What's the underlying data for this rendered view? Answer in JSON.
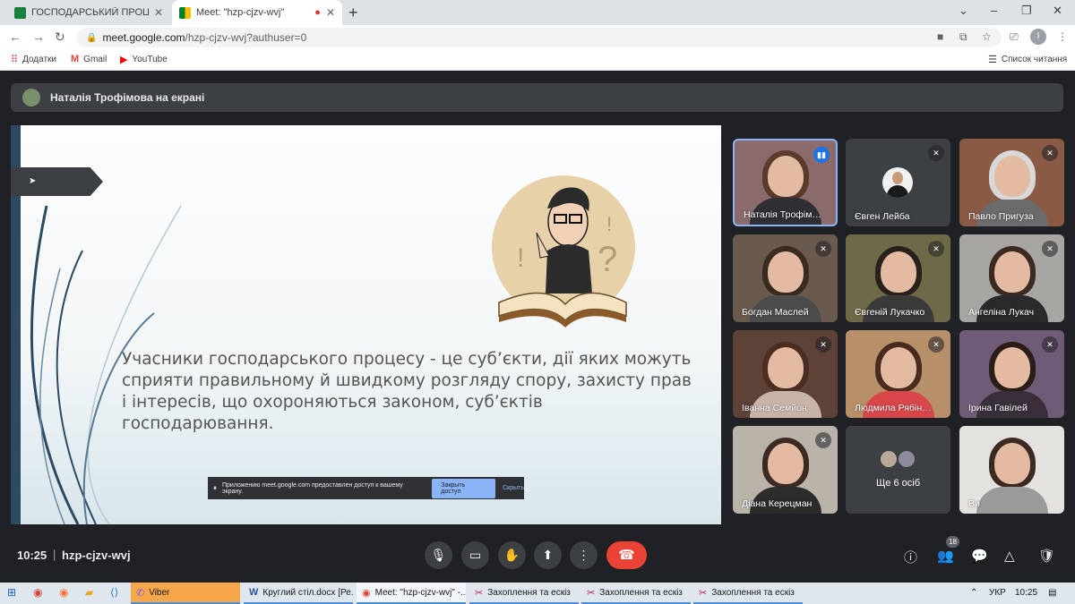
{
  "browser": {
    "tabs": [
      {
        "title": "ГОСПОДАРСЬКИЙ ПРОЦЕС Пр",
        "favicon_color": "#188038"
      },
      {
        "title": "Meet: \"hzp-cjzv-wvj\"",
        "favicon_color": "#00832d",
        "recording": true
      }
    ],
    "new_tab_icon": "plus-icon",
    "window_controls": {
      "minimize": "–",
      "maximize": "❐",
      "close": "✕",
      "dropdown": "⌄"
    },
    "url_host": "meet.google.com",
    "url_path": "/hzp-cjzv-wvj?authuser=0",
    "profile_initial": "I",
    "bookmarks": [
      {
        "label": "Додатки",
        "icon": "apps-grid-icon"
      },
      {
        "label": "Gmail",
        "icon": "gmail-icon"
      },
      {
        "label": "YouTube",
        "icon": "youtube-icon"
      }
    ],
    "reading_list": "Список читання"
  },
  "meet": {
    "presenting_banner": "Наталія Трофімова на екрані",
    "slide": {
      "text": "Учасники господарського процесу - це суб’єкти, дії яких можуть сприяти правильному й швидкому розгляду спору, захисту прав і інтересів, що охороняються законом, суб’єктів господарювання."
    },
    "share_notice": {
      "text": "Приложению meet.google.com предоставлен доступ к вашему экрану.",
      "stop_button": "Закрыть доступ",
      "hide_link": "Скрыть"
    },
    "participants": [
      {
        "name": "Наталія Трофім…",
        "speaking": true
      },
      {
        "name": "Євген Лейба",
        "muted": true
      },
      {
        "name": "Павло Пригуза",
        "muted": true
      },
      {
        "name": "Богдан Маслей",
        "muted": true
      },
      {
        "name": "Євгеній Лукачко",
        "muted": true
      },
      {
        "name": "Ангеліна Лукач",
        "muted": true
      },
      {
        "name": "Іванна Семйон",
        "muted": true
      },
      {
        "name": "Людмила Рябін…",
        "muted": true
      },
      {
        "name": "Ірина Гавілей",
        "muted": true
      },
      {
        "name": "Діана Керецман",
        "muted": true
      },
      {
        "name": "Ще 6 осіб"
      },
      {
        "name": "Ви"
      }
    ],
    "time": "10:25",
    "meeting_code": "hzp-cjzv-wvj",
    "people_count": "18",
    "controls": [
      "microphone-icon",
      "camera-icon",
      "raise-hand-icon",
      "present-screen-icon",
      "more-options-icon",
      "hang-up-icon"
    ],
    "right_controls": [
      "info-icon",
      "people-icon",
      "chat-icon",
      "activities-icon",
      "host-controls-icon"
    ]
  },
  "taskbar": {
    "apps": [
      {
        "label": "Viber",
        "active": true
      },
      {
        "label": "Круглий стіл.docx [Ре..."
      },
      {
        "label": "Meet: \"hzp-cjzv-wvj\" -..."
      },
      {
        "label": "Захоплення та ескіз"
      },
      {
        "label": "Захоплення та ескіз"
      },
      {
        "label": "Захоплення та ескіз"
      }
    ],
    "language": "УКР",
    "time": "10:25"
  },
  "colors": {
    "meet_background": "#202124",
    "hangup": "#ea4335",
    "speaking_blue": "#1a73e8",
    "slide_strip": "#2d4a63"
  }
}
